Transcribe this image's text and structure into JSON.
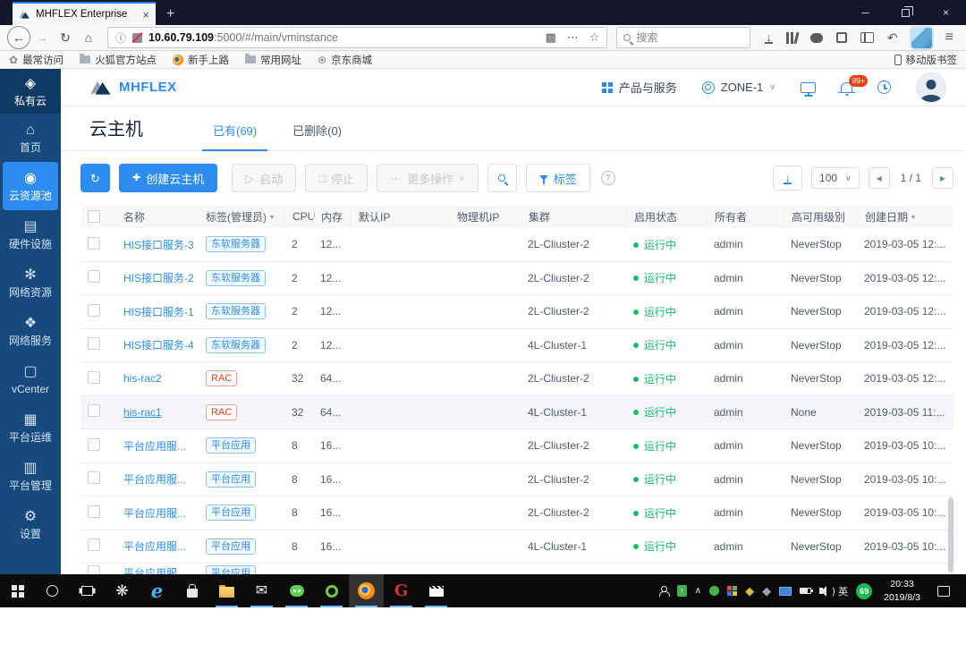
{
  "icons": {
    "tab_close": "×",
    "plus_tab": "+",
    "minimize": "─",
    "close": "×",
    "back": "←",
    "forward": "→",
    "reload": "↻",
    "home": "⌂",
    "info": "ⓘ",
    "qr": "▩",
    "dots": "⋯",
    "star": "☆",
    "undo": "↶",
    "menu": "≡",
    "caret_down": "∨",
    "sort_caret": "▾",
    "refresh": "↻",
    "plus": "✚",
    "play": "▷",
    "stop": "□",
    "more_dots": "⋯",
    "prev": "◀",
    "next": "▶"
  },
  "browser": {
    "tab": {
      "title": "MHFLEX Enterprise"
    },
    "urlbar": {
      "host": "10.60.79.109",
      "rest": ":5000/#/main/vminstance"
    },
    "search": {
      "placeholder": "搜索"
    },
    "bookmarks": [
      {
        "id": "bookmark-most-visited",
        "icon": "pinwheel-icon",
        "kind": "g",
        "glyph": "✿",
        "label": "最常访问"
      },
      {
        "id": "bookmark-firefox-official",
        "icon": "folder-icon",
        "kind": "k-folder-s",
        "glyph": "",
        "label": "火狐官方站点"
      },
      {
        "id": "bookmark-getting-started",
        "icon": "firefox-icon",
        "kind": "k-fx-s",
        "glyph": "",
        "label": "新手上路"
      },
      {
        "id": "bookmark-common-sites",
        "icon": "folder-icon",
        "kind": "k-folder-s",
        "glyph": "",
        "label": "常用网址"
      },
      {
        "id": "bookmark-jd-mall",
        "icon": "globe-icon",
        "kind": "g",
        "glyph": "⊕",
        "label": "京东商城"
      }
    ],
    "mobile_bookmarks_label": "移动版书签"
  },
  "app": {
    "brand": "MHFLEX",
    "header": {
      "products_label": "产品与服务",
      "zone_label": "ZONE-1",
      "notify_badge": "99+"
    },
    "sidebar": {
      "items": [
        {
          "id": "private-cloud",
          "label": "私有云",
          "icon": "private-cloud-icon",
          "glyph": "◈",
          "top": true
        },
        {
          "id": "home",
          "label": "首页",
          "icon": "home-icon",
          "glyph": "⌂"
        },
        {
          "id": "cloud-resource-pool",
          "label": "云资源池",
          "icon": "cloud-pool-icon",
          "glyph": "◉",
          "active": true
        },
        {
          "id": "hardware",
          "label": "硬件设施",
          "icon": "hardware-icon",
          "glyph": "▤"
        },
        {
          "id": "network-resources",
          "label": "网络资源",
          "icon": "network-resource-icon",
          "glyph": "✻"
        },
        {
          "id": "network-services",
          "label": "网络服务",
          "icon": "network-service-icon",
          "glyph": "❖"
        },
        {
          "id": "vcenter",
          "label": "vCenter",
          "icon": "vcenter-icon",
          "glyph": "▢"
        },
        {
          "id": "platform-ops",
          "label": "平台运维",
          "icon": "platform-ops-icon",
          "glyph": "▦"
        },
        {
          "id": "platform-mgmt",
          "label": "平台管理",
          "icon": "platform-mgmt-icon",
          "glyph": "▥"
        },
        {
          "id": "settings",
          "label": "设置",
          "icon": "gear-icon",
          "glyph": "⚙"
        }
      ]
    },
    "page": {
      "title": "云主机",
      "tabs": [
        {
          "label": "已有(69)",
          "active": true
        },
        {
          "label": "已删除(0)",
          "active": false
        }
      ]
    },
    "toolbar": {
      "create_label": "创建云主机",
      "start_label": "启动",
      "stop_label": "停止",
      "more_label": "更多操作",
      "tag_label": "标签",
      "help": "?",
      "page_size": "100",
      "page_indicator": "1 / 1"
    },
    "table": {
      "columns": [
        {
          "label": "名称"
        },
        {
          "label": "标签(管理员)",
          "caret": true
        },
        {
          "label": "CPU"
        },
        {
          "label": "内存"
        },
        {
          "label": "默认IP"
        },
        {
          "label": "物理机IP"
        },
        {
          "label": "集群"
        },
        {
          "label": "启用状态"
        },
        {
          "label": "所有者"
        },
        {
          "label": "高可用级别"
        },
        {
          "label": "创建日期",
          "caret": true
        }
      ],
      "rows": [
        {
          "name": "HIS接口服务-3",
          "tag": "东软服务器",
          "tag_type": "blue",
          "cpu": "2",
          "mem": "12...",
          "default_ip": "",
          "host_ip": "",
          "cluster": "2L-Cliuster-2",
          "status": "运行中",
          "owner": "admin",
          "ha": "NeverStop",
          "created": "2019-03-05 12:..."
        },
        {
          "name": "HIS接口服务-2",
          "tag": "东软服务器",
          "tag_type": "blue",
          "cpu": "2",
          "mem": "12...",
          "default_ip": "",
          "host_ip": "",
          "cluster": "2L-Cliuster-2",
          "status": "运行中",
          "owner": "admin",
          "ha": "NeverStop",
          "created": "2019-03-05 12:..."
        },
        {
          "name": "HIS接口服务-1",
          "tag": "东软服务器",
          "tag_type": "blue",
          "cpu": "2",
          "mem": "12...",
          "default_ip": "",
          "host_ip": "",
          "cluster": "2L-Cliuster-2",
          "status": "运行中",
          "owner": "admin",
          "ha": "NeverStop",
          "created": "2019-03-05 12:..."
        },
        {
          "name": "HIS接口服务-4",
          "tag": "东软服务器",
          "tag_type": "blue",
          "cpu": "2",
          "mem": "12...",
          "default_ip": "",
          "host_ip": "",
          "cluster": "4L-Cluster-1",
          "status": "运行中",
          "owner": "admin",
          "ha": "NeverStop",
          "created": "2019-03-05 12:..."
        },
        {
          "name": "his-rac2",
          "tag": "RAC",
          "tag_type": "red",
          "cpu": "32",
          "mem": "64...",
          "default_ip": "",
          "host_ip": "",
          "cluster": "2L-Cliuster-2",
          "status": "运行中",
          "owner": "admin",
          "ha": "NeverStop",
          "created": "2019-03-05 12:..."
        },
        {
          "name": "his-rac1",
          "tag": "RAC",
          "tag_type": "red",
          "cpu": "32",
          "mem": "64...",
          "default_ip": "",
          "host_ip": "",
          "cluster": "4L-Cluster-1",
          "status": "运行中",
          "owner": "admin",
          "ha": "None",
          "created": "2019-03-05 11:...",
          "highlight": true
        },
        {
          "name": "平台应用服...",
          "tag": "平台应用",
          "tag_type": "blue",
          "cpu": "8",
          "mem": "16...",
          "default_ip": "",
          "host_ip": "",
          "cluster": "2L-Cliuster-2",
          "status": "运行中",
          "owner": "admin",
          "ha": "NeverStop",
          "created": "2019-03-05 10:..."
        },
        {
          "name": "平台应用服...",
          "tag": "平台应用",
          "tag_type": "blue",
          "cpu": "8",
          "mem": "16...",
          "default_ip": "",
          "host_ip": "",
          "cluster": "2L-Cliuster-2",
          "status": "运行中",
          "owner": "admin",
          "ha": "NeverStop",
          "created": "2019-03-05 10:..."
        },
        {
          "name": "平台应用服...",
          "tag": "平台应用",
          "tag_type": "blue",
          "cpu": "8",
          "mem": "16...",
          "default_ip": "",
          "host_ip": "",
          "cluster": "2L-Cliuster-2",
          "status": "运行中",
          "owner": "admin",
          "ha": "NeverStop",
          "created": "2019-03-05 10:..."
        },
        {
          "name": "平台应用服...",
          "tag": "平台应用",
          "tag_type": "blue",
          "cpu": "8",
          "mem": "16...",
          "default_ip": "",
          "host_ip": "",
          "cluster": "4L-Cluster-1",
          "status": "运行中",
          "owner": "admin",
          "ha": "NeverStop",
          "created": "2019-03-05 10:..."
        },
        {
          "name": "平台应用服...",
          "tag": "平台应用",
          "tag_type": "blue",
          "cpu": "",
          "mem": "",
          "default_ip": "",
          "host_ip": "",
          "cluster": "",
          "status": "",
          "owner": "",
          "ha": "",
          "created": "",
          "partial": true
        }
      ]
    }
  },
  "taskbar": {
    "apps": [
      {
        "name": "start-button",
        "icon": "windows-logo-icon",
        "kind": "k-win"
      },
      {
        "name": "search-button",
        "icon": "cortana-circle-icon",
        "kind": "k-ring"
      },
      {
        "name": "task-view-button",
        "icon": "task-view-icon",
        "kind": "k-tv"
      },
      {
        "name": "pinwheel-app-button",
        "icon": "pinwheel-icon",
        "kind": "g",
        "glyph": "❋",
        "color": "#e8e8e8",
        "size": "17px"
      },
      {
        "name": "ie-browser-button",
        "icon": "ie-icon",
        "kind": "k-ie",
        "glyph": "e"
      },
      {
        "name": "store-button",
        "icon": "store-bag-icon",
        "kind": "k-store"
      },
      {
        "name": "file-explorer-button",
        "icon": "folder-icon",
        "kind": "k-folder",
        "open": true
      },
      {
        "name": "mail-app-button",
        "icon": "envelope-icon",
        "kind": "g",
        "glyph": "✉",
        "color": "#f2f2f2",
        "size": "16px",
        "open": true
      },
      {
        "name": "wechat-button",
        "icon": "wechat-bubble-icon",
        "kind": "k-wechat",
        "open": true
      },
      {
        "name": "green-ring-app-button",
        "icon": "green-ring-icon",
        "kind": "k-greenring",
        "open": true
      },
      {
        "name": "firefox-button",
        "icon": "firefox-icon",
        "kind": "k-fx",
        "open": true,
        "active": true
      },
      {
        "name": "red-g-app-button",
        "icon": "red-g-icon",
        "kind": "k-redg",
        "glyph": "G",
        "open": true
      },
      {
        "name": "media-app-button",
        "icon": "clapperboard-icon",
        "kind": "k-clap",
        "open": true
      }
    ],
    "tray": [
      {
        "name": "people-tray-icon",
        "kind": "k-personw"
      },
      {
        "name": "usb-tray-icon",
        "kind": "k-usb"
      },
      {
        "name": "tray-expand-chevron",
        "kind": "g",
        "glyph": "∧",
        "color": "#e8e8e8",
        "size": "10px"
      },
      {
        "name": "green-dot-tray-icon",
        "kind": "k-dotg"
      },
      {
        "name": "grid-app-tray-icon",
        "kind": "k-grid4"
      },
      {
        "name": "yellow-diamond-tray-icon",
        "kind": "g",
        "glyph": "◆",
        "color": "#e3b83a",
        "size": "13px"
      },
      {
        "name": "gray-diamond-tray-icon",
        "kind": "g",
        "glyph": "◆",
        "color": "#9aa0a6",
        "size": "13px"
      },
      {
        "name": "display-tray-icon",
        "kind": "k-disp"
      },
      {
        "name": "battery-tray-icon",
        "kind": "k-batt"
      },
      {
        "name": "volume-tray-icon",
        "kind": "k-spk"
      },
      {
        "name": "ime-indicator",
        "kind": "t",
        "text": "英"
      },
      {
        "name": "battery-percent-badge",
        "kind": "k-b69",
        "text": "69"
      }
    ],
    "time": "20:33",
    "date": "2019/8/3"
  }
}
